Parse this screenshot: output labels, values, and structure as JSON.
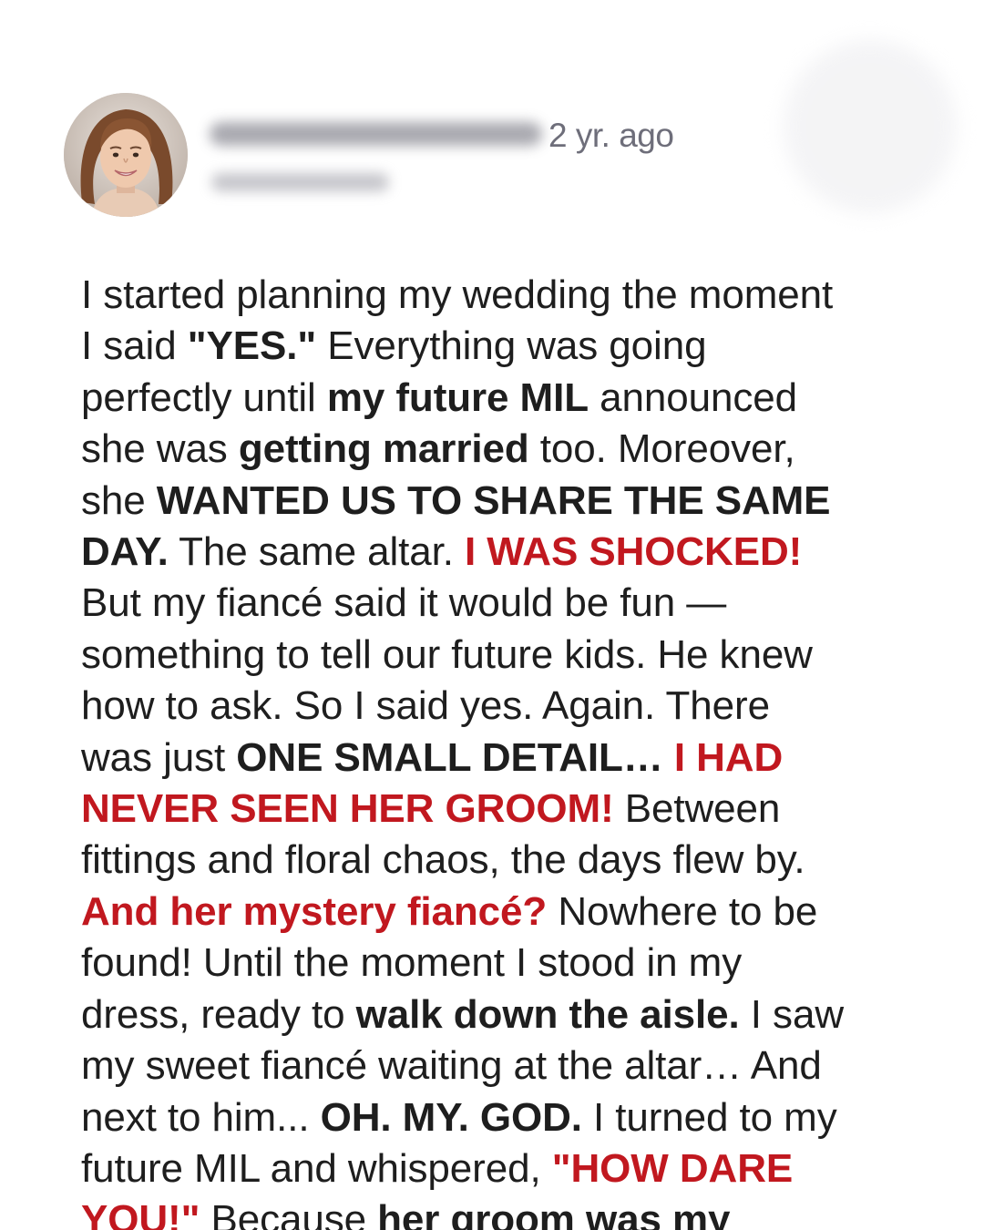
{
  "post": {
    "author": {
      "avatar": "avatar",
      "username_blurred": true,
      "byline_blurred": true
    },
    "timestamp": "2 yr. ago",
    "lines": [
      [
        {
          "t": "I started planning my wedding the moment",
          "s": "n"
        }
      ],
      [
        {
          "t": "I said ",
          "s": "n"
        },
        {
          "t": "\"YES.\"",
          "s": "b"
        },
        {
          "t": " Everything was going",
          "s": "n"
        }
      ],
      [
        {
          "t": "perfectly until ",
          "s": "n"
        },
        {
          "t": "my future MIL",
          "s": "b"
        },
        {
          "t": " announced",
          "s": "n"
        }
      ],
      [
        {
          "t": "she was ",
          "s": "n"
        },
        {
          "t": "getting married",
          "s": "b"
        },
        {
          "t": " too. Moreover,",
          "s": "n"
        }
      ],
      [
        {
          "t": "she ",
          "s": "n"
        },
        {
          "t": "WANTED US TO SHARE THE SAME",
          "s": "b"
        }
      ],
      [
        {
          "t": "DAY.",
          "s": "b"
        },
        {
          "t": " The same altar. ",
          "s": "n"
        },
        {
          "t": "I WAS SHOCKED!",
          "s": "r"
        }
      ],
      [
        {
          "t": "But my fiancé said it would be fun —",
          "s": "n"
        }
      ],
      [
        {
          "t": "something to tell our future kids. He knew",
          "s": "n"
        }
      ],
      [
        {
          "t": "how to ask. So I said yes. Again. There",
          "s": "n"
        }
      ],
      [
        {
          "t": "was just ",
          "s": "n"
        },
        {
          "t": "ONE SMALL DETAIL…",
          "s": "b"
        },
        {
          "t": " I HAD",
          "s": "r"
        }
      ],
      [
        {
          "t": "NEVER SEEN HER GROOM!",
          "s": "r"
        },
        {
          "t": " Between",
          "s": "n"
        }
      ],
      [
        {
          "t": "fittings and floral chaos, the days flew by.",
          "s": "n"
        }
      ],
      [
        {
          "t": "And her mystery fiancé?",
          "s": "r"
        },
        {
          "t": " Nowhere to be",
          "s": "n"
        }
      ],
      [
        {
          "t": "found! Until the moment I stood in my",
          "s": "n"
        }
      ],
      [
        {
          "t": "dress, ready to ",
          "s": "n"
        },
        {
          "t": "walk down the aisle.",
          "s": "b"
        },
        {
          "t": " I saw",
          "s": "n"
        }
      ],
      [
        {
          "t": "my sweet fiancé waiting at the altar… And",
          "s": "n"
        }
      ],
      [
        {
          "t": "next to him... ",
          "s": "n"
        },
        {
          "t": "OH. MY. GOD.",
          "s": "b"
        },
        {
          "t": " I turned to my",
          "s": "n"
        }
      ],
      [
        {
          "t": "future MIL and whispered, ",
          "s": "n"
        },
        {
          "t": "\"HOW DARE",
          "s": "r"
        }
      ],
      [
        {
          "t": "YOU!\"",
          "s": "r"
        },
        {
          "t": " Because ",
          "s": "n"
        },
        {
          "t": "her groom was my",
          "s": "b"
        }
      ]
    ]
  },
  "colors": {
    "text": "#1e1e1e",
    "emphasis_red": "#c1181f",
    "timestamp": "#6e6e7a",
    "background": "#ffffff"
  }
}
